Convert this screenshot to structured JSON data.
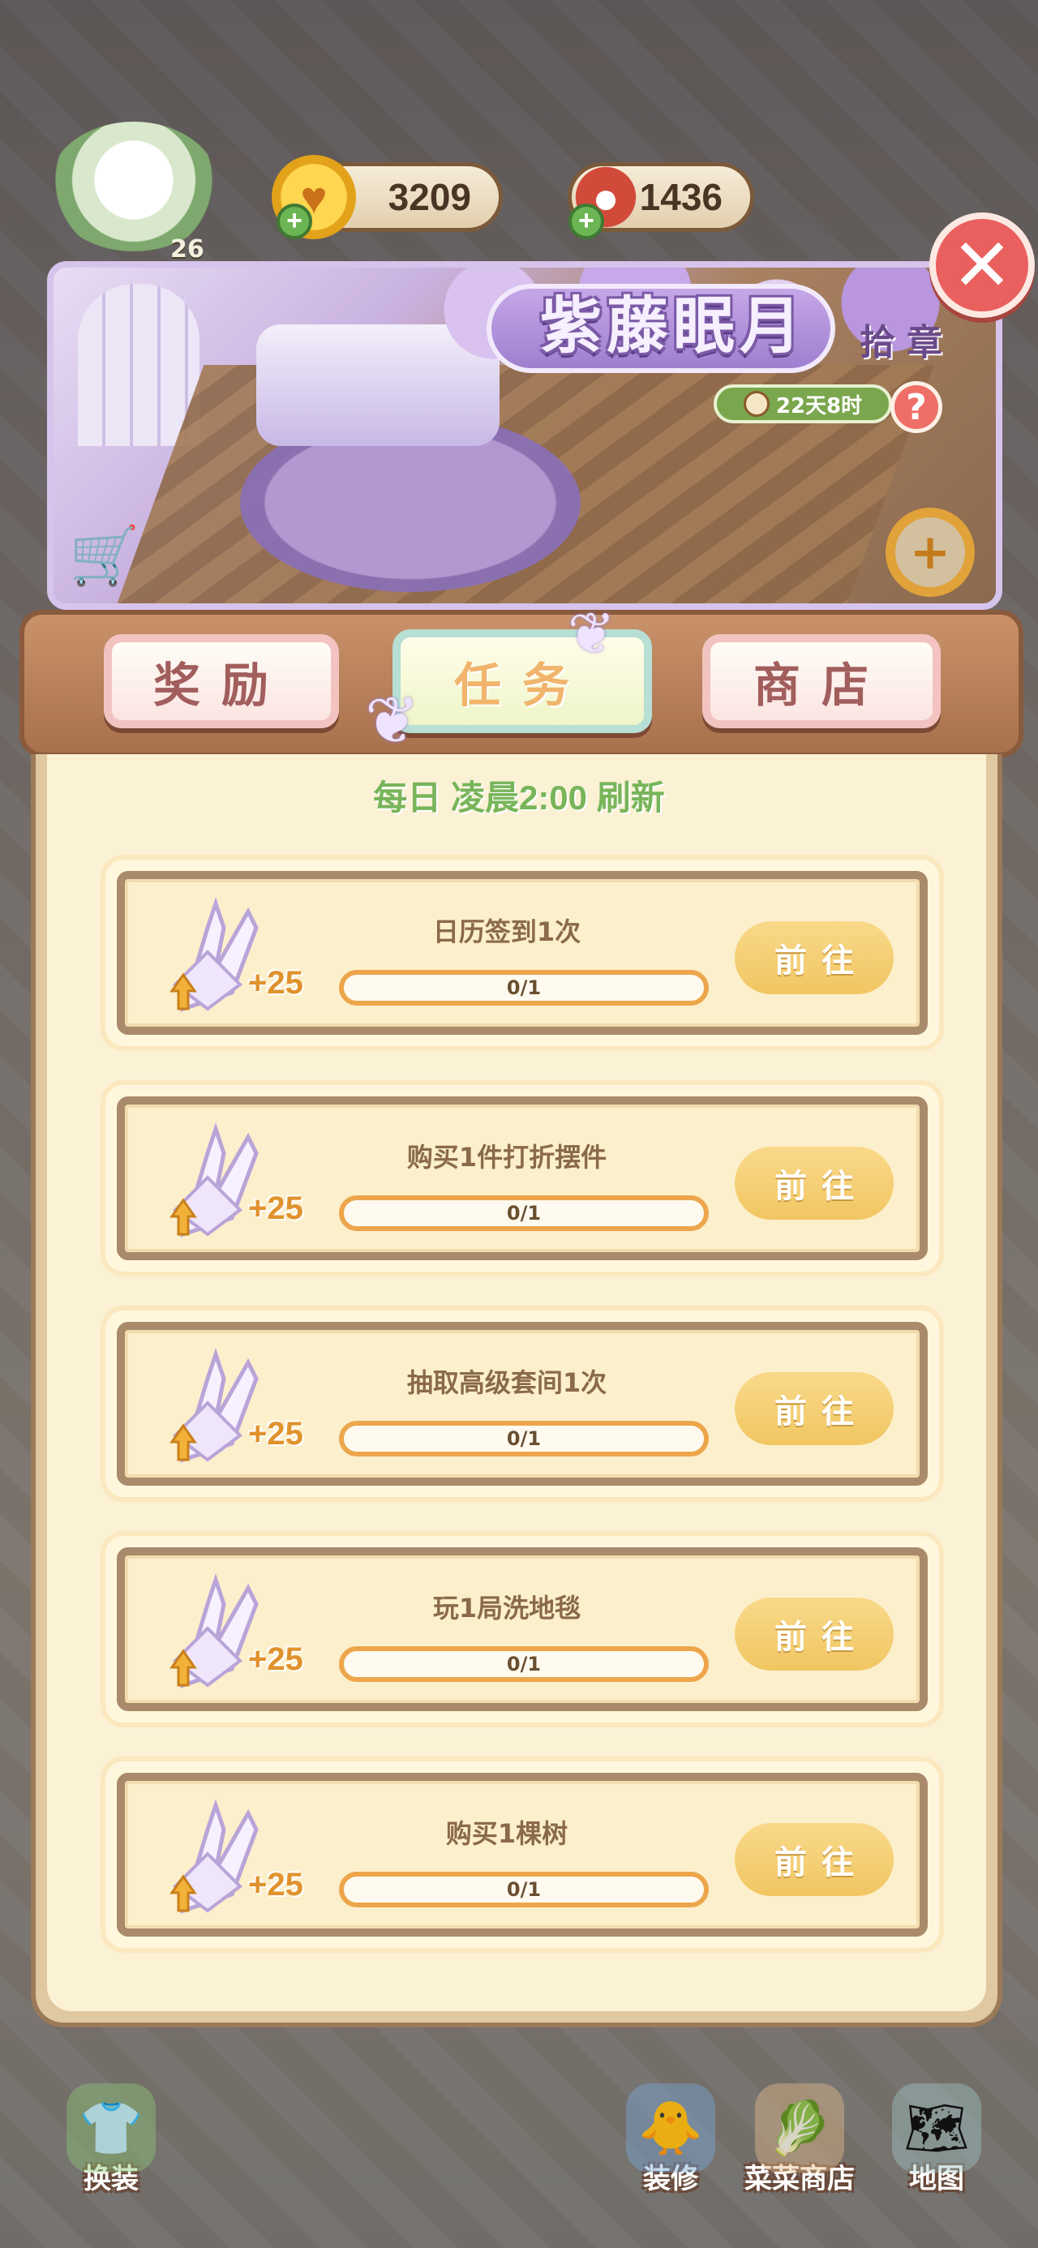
{
  "hud": {
    "level": "26",
    "coins": "3209",
    "cherries": "1436"
  },
  "event": {
    "title": "紫藤眠月",
    "subtitle": "拾章",
    "countdown": "22天8时",
    "help_label": "?"
  },
  "tabs": [
    {
      "label": "奖励",
      "active": false
    },
    {
      "label": "任务",
      "active": true
    },
    {
      "label": "商店",
      "active": false
    }
  ],
  "refresh_note": "每日 凌晨2:00 刷新",
  "tasks": [
    {
      "title": "日历签到1次",
      "reward": "+25",
      "progress": "0/1",
      "progress_value": 0,
      "button": "前往"
    },
    {
      "title": "购买1件打折摆件",
      "reward": "+25",
      "progress": "0/1",
      "progress_value": 0,
      "button": "前往"
    },
    {
      "title": "抽取高级套间1次",
      "reward": "+25",
      "progress": "0/1",
      "progress_value": 0,
      "button": "前往"
    },
    {
      "title": "玩1局洗地毯",
      "reward": "+25",
      "progress": "0/1",
      "progress_value": 0,
      "button": "前往"
    },
    {
      "title": "购买1棵树",
      "reward": "+25",
      "progress": "0/1",
      "progress_value": 0,
      "button": "前往"
    }
  ],
  "bottom_nav": [
    {
      "label": "换装",
      "icon": "dress-up-icon"
    },
    {
      "label": "装修",
      "icon": "decorate-icon"
    },
    {
      "label": "菜菜商店",
      "icon": "shop-icon"
    },
    {
      "label": "地图",
      "icon": "map-icon"
    }
  ],
  "colors": {
    "accent_green": "#78b55a",
    "button_gold": "#f1c662",
    "tab_active_text": "#f1b46c",
    "close_red": "#e9605e"
  }
}
